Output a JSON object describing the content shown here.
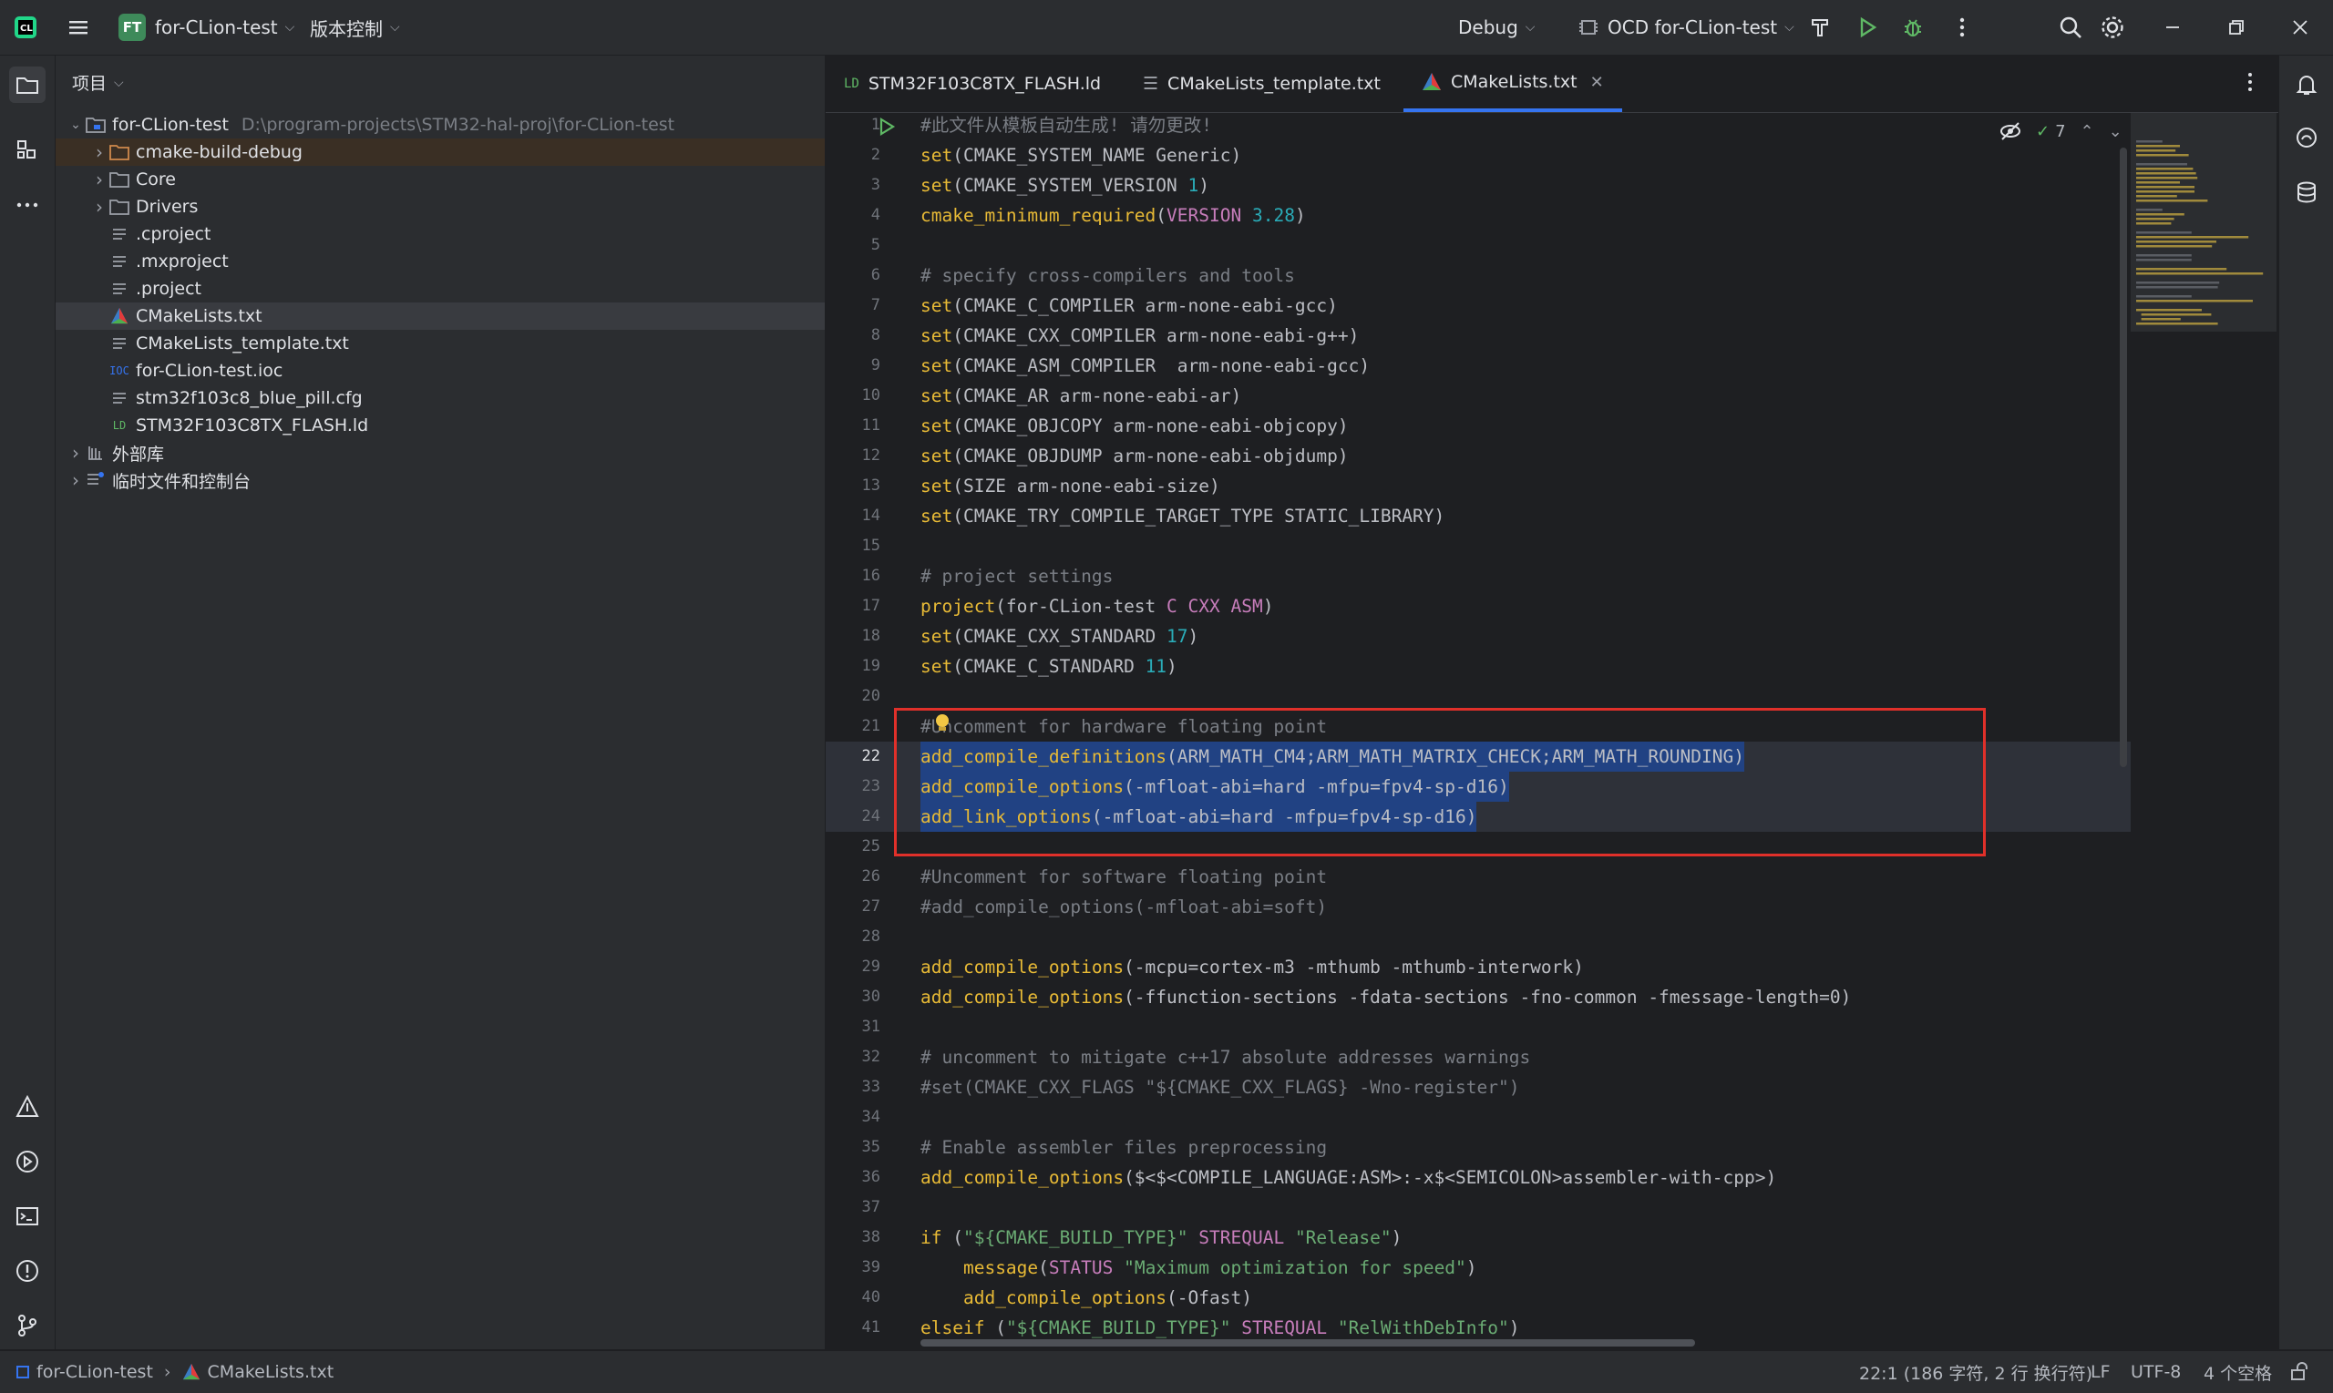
{
  "titlebar": {
    "project_badge": "FT",
    "project_name": "for-CLion-test",
    "vcs_label": "版本控制",
    "config_label": "Debug",
    "run_target": "OCD for-CLion-test"
  },
  "project_panel": {
    "header": "项目",
    "tree": [
      {
        "label": "for-CLion-test",
        "path": "D:\\program-projects\\STM32-hal-proj\\for-CLion-test",
        "type": "project-root",
        "expanded": true
      },
      {
        "label": "cmake-build-debug",
        "type": "folder-excluded",
        "expanded": false
      },
      {
        "label": "Core",
        "type": "folder",
        "expanded": false
      },
      {
        "label": "Drivers",
        "type": "folder",
        "expanded": false
      },
      {
        "label": ".cproject",
        "type": "file"
      },
      {
        "label": ".mxproject",
        "type": "file"
      },
      {
        "label": ".project",
        "type": "file"
      },
      {
        "label": "CMakeLists.txt",
        "type": "cmake",
        "selected": true
      },
      {
        "label": "CMakeLists_template.txt",
        "type": "file"
      },
      {
        "label": "for-CLion-test.ioc",
        "type": "ioc"
      },
      {
        "label": "stm32f103c8_blue_pill.cfg",
        "type": "file"
      },
      {
        "label": "STM32F103C8TX_FLASH.ld",
        "type": "ld"
      },
      {
        "label": "外部库",
        "type": "library",
        "expanded": false
      },
      {
        "label": "临时文件和控制台",
        "type": "scratch",
        "expanded": false
      }
    ]
  },
  "tabs": [
    {
      "label": "STM32F103C8TX_FLASH.ld",
      "icon": "ld-file-icon",
      "active": false
    },
    {
      "label": "CMakeLists_template.txt",
      "icon": "text-file-icon",
      "active": false
    },
    {
      "label": "CMakeLists.txt",
      "icon": "cmake-icon",
      "active": true
    }
  ],
  "editor": {
    "inspection_count": "7",
    "current_line": 22,
    "lines": [
      "#此文件从模板自动生成! 请勿更改!",
      "set(CMAKE_SYSTEM_NAME Generic)",
      "set(CMAKE_SYSTEM_VERSION 1)",
      "cmake_minimum_required(VERSION 3.28)",
      "",
      "# specify cross-compilers and tools",
      "set(CMAKE_C_COMPILER arm-none-eabi-gcc)",
      "set(CMAKE_CXX_COMPILER arm-none-eabi-g++)",
      "set(CMAKE_ASM_COMPILER  arm-none-eabi-gcc)",
      "set(CMAKE_AR arm-none-eabi-ar)",
      "set(CMAKE_OBJCOPY arm-none-eabi-objcopy)",
      "set(CMAKE_OBJDUMP arm-none-eabi-objdump)",
      "set(SIZE arm-none-eabi-size)",
      "set(CMAKE_TRY_COMPILE_TARGET_TYPE STATIC_LIBRARY)",
      "",
      "# project settings",
      "project(for-CLion-test C CXX ASM)",
      "set(CMAKE_CXX_STANDARD 17)",
      "set(CMAKE_C_STANDARD 11)",
      "",
      "#Uncomment for hardware floating point",
      "add_compile_definitions(ARM_MATH_CM4;ARM_MATH_MATRIX_CHECK;ARM_MATH_ROUNDING)",
      "add_compile_options(-mfloat-abi=hard -mfpu=fpv4-sp-d16)",
      "add_link_options(-mfloat-abi=hard -mfpu=fpv4-sp-d16)",
      "",
      "#Uncomment for software floating point",
      "#add_compile_options(-mfloat-abi=soft)",
      "",
      "add_compile_options(-mcpu=cortex-m3 -mthumb -mthumb-interwork)",
      "add_compile_options(-ffunction-sections -fdata-sections -fno-common -fmessage-length=0)",
      "",
      "# uncomment to mitigate c++17 absolute addresses warnings",
      "#set(CMAKE_CXX_FLAGS \"${CMAKE_CXX_FLAGS} -Wno-register\")",
      "",
      "# Enable assembler files preprocessing",
      "add_compile_options($<$<COMPILE_LANGUAGE:ASM>:-x$<SEMICOLON>assembler-with-cpp>)",
      "",
      "if (\"${CMAKE_BUILD_TYPE}\" STREQUAL \"Release\")",
      "    message(STATUS \"Maximum optimization for speed\")",
      "    add_compile_options(-Ofast)",
      "elseif (\"${CMAKE_BUILD_TYPE}\" STREQUAL \"RelWithDebInfo\")"
    ]
  },
  "statusbar": {
    "breadcrumb_project": "for-CLion-test",
    "breadcrumb_file": "CMakeLists.txt",
    "position": "22:1 (186 字符, 2 行 换行符)",
    "line_ending": "LF",
    "encoding": "UTF-8",
    "indent": "4 个空格"
  },
  "colors": {
    "accent": "#3574f0",
    "highlight_box": "#e0302a",
    "keyword": "#e8ba36",
    "comment": "#7a7e85",
    "number": "#2aacb8",
    "string": "#6aab73"
  }
}
